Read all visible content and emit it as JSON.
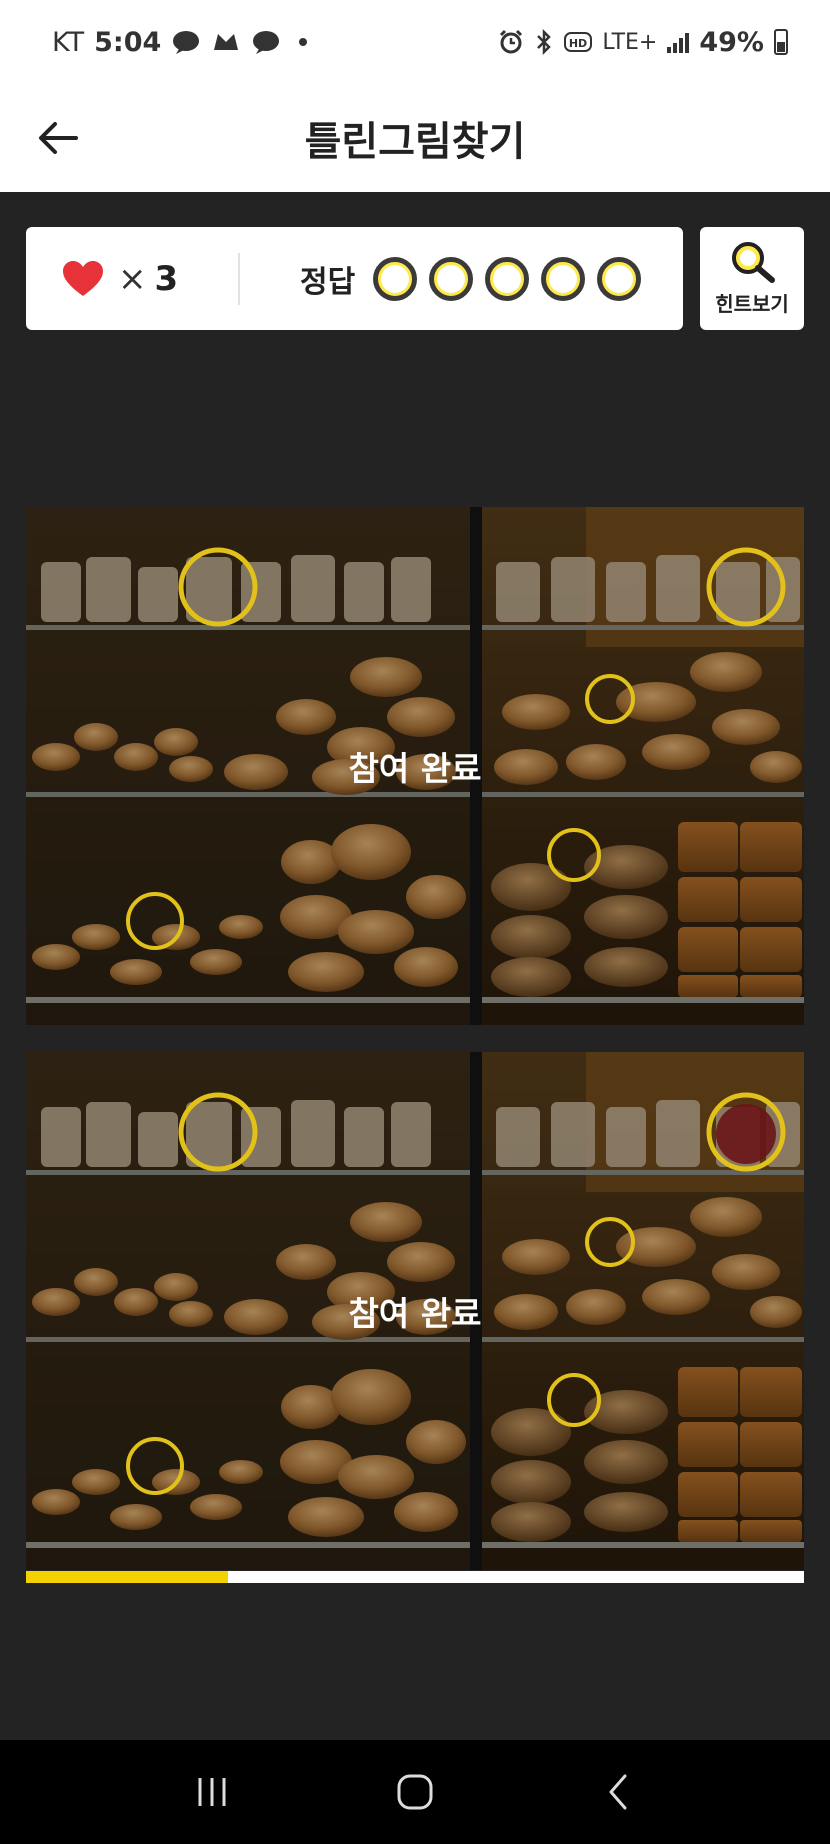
{
  "status_bar": {
    "carrier": "KT",
    "time": "5:04",
    "network": "LTE+",
    "battery": "49%"
  },
  "header": {
    "title": "틀린그림찾기"
  },
  "score": {
    "lives_count": "3",
    "times_symbol": "×",
    "answers_label": "정답",
    "answers_total": 5
  },
  "hint": {
    "label": "힌트보기"
  },
  "puzzles": {
    "top_status": "참여 완료",
    "bottom_status": "참여 완료"
  },
  "progress": {
    "fraction": 0.26
  },
  "colors": {
    "accent_yellow": "#f2d200",
    "heart_red": "#e8323a",
    "background": "#232323"
  },
  "icons": {
    "back": "arrow-left-icon",
    "life": "heart-icon",
    "hint": "magnifier-icon",
    "nav_recent": "recent-apps-icon",
    "nav_home": "home-icon",
    "nav_back": "back-icon"
  }
}
